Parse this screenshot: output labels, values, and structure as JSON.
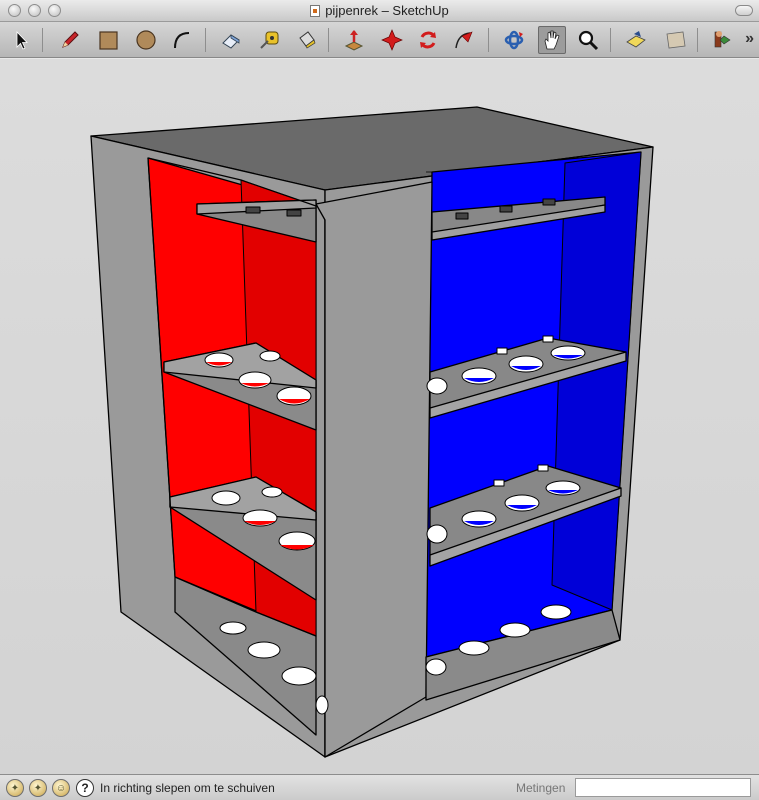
{
  "window": {
    "title": "pijpenrek – SketchUp"
  },
  "toolbar": {
    "tools": [
      {
        "name": "select-tool-icon"
      },
      {
        "name": "pencil-tool-icon"
      },
      {
        "name": "rectangle-tool-icon"
      },
      {
        "name": "circle-tool-icon"
      },
      {
        "name": "arc-tool-icon"
      },
      {
        "name": "eraser-tool-icon"
      },
      {
        "name": "tape-measure-icon"
      },
      {
        "name": "paint-bucket-icon"
      },
      {
        "name": "push-pull-icon"
      },
      {
        "name": "move-tool-icon"
      },
      {
        "name": "rotate-tool-icon"
      },
      {
        "name": "follow-me-icon"
      },
      {
        "name": "orbit-tool-icon"
      },
      {
        "name": "pan-tool-icon"
      },
      {
        "name": "zoom-tool-icon"
      },
      {
        "name": "zoom-extents-icon"
      },
      {
        "name": "previous-view-icon"
      },
      {
        "name": "components-icon"
      }
    ],
    "overflow_label": "»"
  },
  "model": {
    "colors": {
      "gray": "#999999",
      "red": "#ff0000",
      "blue": "#0000ff"
    }
  },
  "statusbar": {
    "message": "In richting slepen om te schuiven",
    "help_label": "?",
    "measurements_label": "Metingen",
    "measurements_value": ""
  }
}
